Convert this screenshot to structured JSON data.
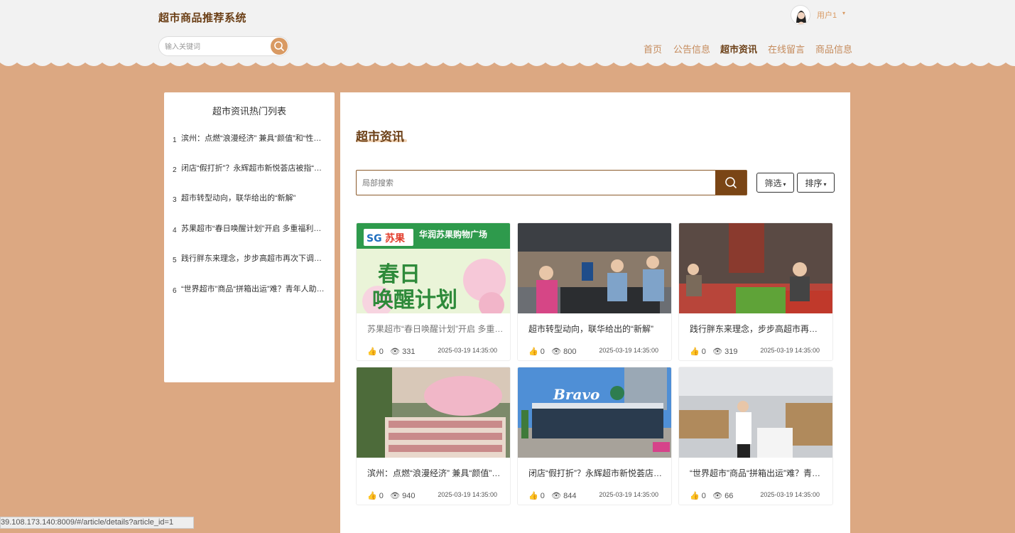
{
  "header": {
    "site_title": "超市商品推荐系统",
    "search_placeholder": "输入关键词",
    "user_name": "用户1",
    "user_caret": "▾",
    "nav": [
      "首页",
      "公告信息",
      "超市资讯",
      "在线留言",
      "商品信息"
    ],
    "active_nav": "超市资讯"
  },
  "sidebar": {
    "title": "超市资讯热门列表",
    "items": [
      {
        "num": "1",
        "title": "滨州：点燃“浪漫经济” 兼具“颜值”和“性价比”的鲜花走俏"
      },
      {
        "num": "2",
        "title": "闭店“假打折”？永辉超市新悦荟店被指“以次充好”"
      },
      {
        "num": "3",
        "title": "超市转型动向，联华给出的“新解”"
      },
      {
        "num": "4",
        "title": "苏果超市“春日唤醒计划”开启 多重福利等你来"
      },
      {
        "num": "5",
        "title": "践行胖东来理念，步步高超市再次下调商品价格"
      },
      {
        "num": "6",
        "title": "“世界超市”商品“拼箱出运”难？青年人助力破解"
      }
    ]
  },
  "main": {
    "title": "超市资讯",
    "local_search_placeholder": "局部搜索",
    "filter_label": "筛选",
    "sort_label": "排序",
    "caret": "▾",
    "cards": [
      {
        "title": "苏果超市“春日唤醒计划”开启 多重福利等你来",
        "likes": "0",
        "views": "331",
        "date": "2025-03-19 14:35:00",
        "image": "sugo-spring-banner"
      },
      {
        "title": "超市转型动向，联华给出的“新解”",
        "likes": "0",
        "views": "800",
        "date": "2025-03-19 14:35:00",
        "image": "checkout-counter-photo"
      },
      {
        "title": "践行胖东来理念，步步高超市再次下调商品价格",
        "likes": "0",
        "views": "319",
        "date": "2025-03-19 14:35:00",
        "image": "vegetable-shelves-photo"
      },
      {
        "title": "滨州：点燃“浪漫经济” 兼具“颜值”和“性价比”的鲜花走俏",
        "likes": "0",
        "views": "940",
        "date": "2025-03-19 14:35:00",
        "image": "flower-display-photo"
      },
      {
        "title": "闭店“假打折”？永辉超市新悦荟店被指“以次充好”",
        "likes": "0",
        "views": "844",
        "date": "2025-03-19 14:35:00",
        "image": "bravo-storefront-photo"
      },
      {
        "title": "“世界超市”商品“拼箱出运”难？青年人助力破解",
        "likes": "0",
        "views": "66",
        "date": "2025-03-19 14:35:00",
        "image": "warehouse-boxes-photo"
      }
    ]
  },
  "banner": {
    "brand": "苏果",
    "mall": "华润苏果购物广场",
    "line1": "春日",
    "line2": "唤醒计划"
  },
  "status_bar": "39.108.173.140:8009/#/article/details?article_id=1",
  "colors": {
    "brand_brown": "#6b3f16",
    "accent": "#d99a63",
    "page_bg": "#dca882",
    "search_btn": "#7a4515"
  }
}
